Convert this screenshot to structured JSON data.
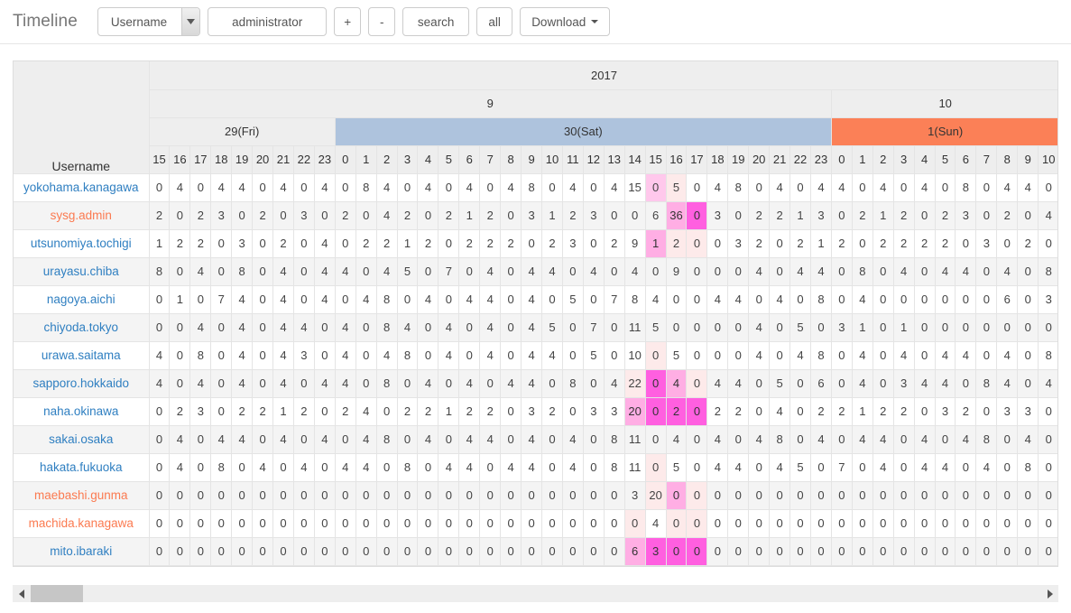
{
  "toolbar": {
    "app_title": "Timeline",
    "filter_field": {
      "selected": "Username",
      "arrow_icon": "chevron-down-icon"
    },
    "filter_value": "administrator",
    "add_label": "+",
    "remove_label": "-",
    "search_label": "search",
    "all_label": "all",
    "download_label": "Download"
  },
  "table": {
    "corner_label": "Username",
    "year": "2017",
    "months": [
      {
        "label": "9",
        "span": 33
      },
      {
        "label": "10",
        "span": 11
      }
    ],
    "days": [
      {
        "label": "29(Fri)",
        "span": 9,
        "kind": "weekday"
      },
      {
        "label": "30(Sat)",
        "span": 24,
        "kind": "saturday"
      },
      {
        "label": "1(Sun)",
        "span": 11,
        "kind": "sunday"
      }
    ],
    "hours": [
      15,
      16,
      17,
      18,
      19,
      20,
      21,
      22,
      23,
      0,
      1,
      2,
      3,
      4,
      5,
      6,
      7,
      8,
      9,
      10,
      11,
      12,
      13,
      14,
      15,
      16,
      17,
      18,
      19,
      20,
      21,
      22,
      23,
      0,
      1,
      2,
      3,
      4,
      5,
      6,
      7,
      8,
      9,
      10
    ],
    "rows": [
      {
        "username": "yokohama.kanagawa",
        "alert": false,
        "values": [
          0,
          4,
          0,
          4,
          4,
          0,
          4,
          0,
          4,
          0,
          8,
          4,
          0,
          4,
          0,
          4,
          0,
          4,
          8,
          0,
          4,
          0,
          4,
          15,
          0,
          5,
          0,
          4,
          8,
          0,
          4,
          0,
          4,
          4,
          0,
          4,
          0,
          4,
          0,
          8,
          0,
          4,
          4,
          0
        ],
        "heat": [
          0,
          0,
          0,
          0,
          0,
          0,
          0,
          0,
          0,
          0,
          0,
          0,
          0,
          0,
          0,
          0,
          0,
          0,
          0,
          0,
          0,
          0,
          0,
          0,
          2,
          1,
          0,
          0,
          0,
          0,
          0,
          0,
          0,
          0,
          0,
          0,
          0,
          0,
          0,
          0,
          0,
          0,
          0,
          0
        ]
      },
      {
        "username": "sysg.admin",
        "alert": true,
        "values": [
          2,
          0,
          2,
          3,
          0,
          2,
          0,
          3,
          0,
          2,
          0,
          4,
          2,
          0,
          2,
          1,
          2,
          0,
          3,
          1,
          2,
          3,
          0,
          0,
          6,
          36,
          0,
          3,
          0,
          2,
          2,
          1,
          3,
          0,
          2,
          1,
          2,
          0,
          2,
          3,
          0,
          2,
          0,
          4
        ],
        "heat": [
          0,
          0,
          0,
          0,
          0,
          0,
          0,
          0,
          0,
          0,
          0,
          0,
          0,
          0,
          0,
          0,
          0,
          0,
          0,
          0,
          0,
          0,
          0,
          0,
          0,
          3,
          4,
          0,
          0,
          0,
          0,
          0,
          0,
          0,
          0,
          0,
          0,
          0,
          0,
          0,
          0,
          0,
          0,
          0
        ]
      },
      {
        "username": "utsunomiya.tochigi",
        "alert": false,
        "values": [
          1,
          2,
          2,
          0,
          3,
          0,
          2,
          0,
          4,
          0,
          2,
          2,
          1,
          2,
          0,
          2,
          2,
          2,
          0,
          2,
          3,
          0,
          2,
          9,
          1,
          2,
          0,
          0,
          3,
          2,
          0,
          2,
          1,
          2,
          0,
          2,
          2,
          2,
          2,
          0,
          3,
          0,
          2,
          0
        ],
        "heat": [
          0,
          0,
          0,
          0,
          0,
          0,
          0,
          0,
          0,
          0,
          0,
          0,
          0,
          0,
          0,
          0,
          0,
          0,
          0,
          0,
          0,
          0,
          0,
          0,
          3,
          1,
          1,
          0,
          0,
          0,
          0,
          0,
          0,
          0,
          0,
          0,
          0,
          0,
          0,
          0,
          0,
          0,
          0,
          0
        ]
      },
      {
        "username": "urayasu.chiba",
        "alert": false,
        "values": [
          8,
          0,
          4,
          0,
          8,
          0,
          4,
          0,
          4,
          4,
          0,
          4,
          5,
          0,
          7,
          0,
          4,
          0,
          4,
          4,
          0,
          4,
          0,
          4,
          0,
          9,
          0,
          0,
          0,
          4,
          0,
          4,
          4,
          0,
          8,
          0,
          4,
          0,
          4,
          4,
          0,
          4,
          0,
          8
        ],
        "heat": [
          0,
          0,
          0,
          0,
          0,
          0,
          0,
          0,
          0,
          0,
          0,
          0,
          0,
          0,
          0,
          0,
          0,
          0,
          0,
          0,
          0,
          0,
          0,
          0,
          0,
          0,
          0,
          0,
          0,
          0,
          0,
          0,
          0,
          0,
          0,
          0,
          0,
          0,
          0,
          0,
          0,
          0,
          0,
          0
        ]
      },
      {
        "username": "nagoya.aichi",
        "alert": false,
        "values": [
          0,
          1,
          0,
          7,
          4,
          0,
          4,
          0,
          4,
          0,
          4,
          8,
          0,
          4,
          0,
          4,
          4,
          0,
          4,
          0,
          5,
          0,
          7,
          8,
          4,
          0,
          0,
          4,
          4,
          0,
          4,
          0,
          8,
          0,
          4,
          0,
          0,
          0,
          0,
          0,
          0,
          6,
          0,
          3
        ],
        "heat": [
          0,
          0,
          0,
          0,
          0,
          0,
          0,
          0,
          0,
          0,
          0,
          0,
          0,
          0,
          0,
          0,
          0,
          0,
          0,
          0,
          0,
          0,
          0,
          0,
          0,
          0,
          0,
          0,
          0,
          0,
          0,
          0,
          0,
          0,
          0,
          0,
          0,
          0,
          0,
          0,
          0,
          0,
          0,
          0
        ]
      },
      {
        "username": "chiyoda.tokyo",
        "alert": false,
        "values": [
          0,
          0,
          4,
          0,
          4,
          0,
          4,
          4,
          0,
          4,
          0,
          8,
          4,
          0,
          4,
          0,
          4,
          0,
          4,
          5,
          0,
          7,
          0,
          11,
          5,
          0,
          0,
          0,
          0,
          4,
          0,
          5,
          0,
          3,
          1,
          0,
          1,
          0,
          0,
          0,
          0,
          0,
          0,
          0
        ],
        "heat": [
          0,
          0,
          0,
          0,
          0,
          0,
          0,
          0,
          0,
          0,
          0,
          0,
          0,
          0,
          0,
          0,
          0,
          0,
          0,
          0,
          0,
          0,
          0,
          0,
          0,
          0,
          0,
          0,
          0,
          0,
          0,
          0,
          0,
          0,
          0,
          0,
          0,
          0,
          0,
          0,
          0,
          0,
          0,
          0
        ]
      },
      {
        "username": "urawa.saitama",
        "alert": false,
        "values": [
          4,
          0,
          8,
          0,
          4,
          0,
          4,
          3,
          0,
          4,
          0,
          4,
          8,
          0,
          4,
          0,
          4,
          0,
          4,
          4,
          0,
          5,
          0,
          10,
          0,
          5,
          0,
          0,
          0,
          4,
          0,
          4,
          8,
          0,
          4,
          0,
          4,
          0,
          4,
          4,
          0,
          4,
          0,
          8
        ],
        "heat": [
          0,
          0,
          0,
          0,
          0,
          0,
          0,
          0,
          0,
          0,
          0,
          0,
          0,
          0,
          0,
          0,
          0,
          0,
          0,
          0,
          0,
          0,
          0,
          0,
          1,
          0,
          0,
          0,
          0,
          0,
          0,
          0,
          0,
          0,
          0,
          0,
          0,
          0,
          0,
          0,
          0,
          0,
          0,
          0
        ]
      },
      {
        "username": "sapporo.hokkaido",
        "alert": false,
        "values": [
          4,
          0,
          4,
          0,
          4,
          0,
          4,
          0,
          4,
          4,
          0,
          8,
          0,
          4,
          0,
          4,
          0,
          4,
          4,
          0,
          8,
          0,
          4,
          22,
          0,
          4,
          0,
          4,
          4,
          0,
          5,
          0,
          6,
          0,
          4,
          0,
          3,
          4,
          4,
          0,
          8,
          4,
          0,
          4
        ],
        "heat": [
          0,
          0,
          0,
          0,
          0,
          0,
          0,
          0,
          0,
          0,
          0,
          0,
          0,
          0,
          0,
          0,
          0,
          0,
          0,
          0,
          0,
          0,
          0,
          1,
          4,
          3,
          1,
          0,
          0,
          0,
          0,
          0,
          0,
          0,
          0,
          0,
          0,
          0,
          0,
          0,
          0,
          0,
          0,
          0
        ]
      },
      {
        "username": "naha.okinawa",
        "alert": false,
        "values": [
          0,
          2,
          3,
          0,
          2,
          2,
          1,
          2,
          0,
          2,
          4,
          0,
          2,
          2,
          1,
          2,
          2,
          0,
          3,
          2,
          0,
          3,
          3,
          20,
          0,
          2,
          0,
          2,
          2,
          0,
          4,
          0,
          2,
          2,
          1,
          2,
          2,
          0,
          3,
          2,
          0,
          3,
          3,
          0
        ],
        "heat": [
          0,
          0,
          0,
          0,
          0,
          0,
          0,
          0,
          0,
          0,
          0,
          0,
          0,
          0,
          0,
          0,
          0,
          0,
          0,
          0,
          0,
          0,
          0,
          3,
          4,
          4,
          4,
          0,
          0,
          0,
          0,
          0,
          0,
          0,
          0,
          0,
          0,
          0,
          0,
          0,
          0,
          0,
          0,
          0
        ]
      },
      {
        "username": "sakai.osaka",
        "alert": false,
        "values": [
          0,
          4,
          0,
          4,
          4,
          0,
          4,
          0,
          4,
          0,
          4,
          8,
          0,
          4,
          0,
          4,
          4,
          0,
          4,
          0,
          4,
          0,
          8,
          11,
          0,
          4,
          0,
          4,
          0,
          4,
          8,
          0,
          4,
          0,
          4,
          4,
          0,
          4,
          0,
          4,
          8,
          0,
          4,
          0
        ],
        "heat": [
          0,
          0,
          0,
          0,
          0,
          0,
          0,
          0,
          0,
          0,
          0,
          0,
          0,
          0,
          0,
          0,
          0,
          0,
          0,
          0,
          0,
          0,
          0,
          0,
          0,
          0,
          0,
          0,
          0,
          0,
          0,
          0,
          0,
          0,
          0,
          0,
          0,
          0,
          0,
          0,
          0,
          0,
          0,
          0
        ]
      },
      {
        "username": "hakata.fukuoka",
        "alert": false,
        "values": [
          0,
          4,
          0,
          8,
          0,
          4,
          0,
          4,
          0,
          4,
          4,
          0,
          8,
          0,
          4,
          4,
          0,
          4,
          4,
          0,
          4,
          0,
          8,
          11,
          0,
          5,
          0,
          4,
          4,
          0,
          4,
          5,
          0,
          7,
          0,
          4,
          0,
          4,
          4,
          0,
          4,
          0,
          8,
          0
        ],
        "heat": [
          0,
          0,
          0,
          0,
          0,
          0,
          0,
          0,
          0,
          0,
          0,
          0,
          0,
          0,
          0,
          0,
          0,
          0,
          0,
          0,
          0,
          0,
          0,
          0,
          1,
          0,
          0,
          0,
          0,
          0,
          0,
          0,
          0,
          0,
          0,
          0,
          0,
          0,
          0,
          0,
          0,
          0,
          0,
          0
        ]
      },
      {
        "username": "maebashi.gunma",
        "alert": true,
        "values": [
          0,
          0,
          0,
          0,
          0,
          0,
          0,
          0,
          0,
          0,
          0,
          0,
          0,
          0,
          0,
          0,
          0,
          0,
          0,
          0,
          0,
          0,
          0,
          3,
          20,
          0,
          0,
          0,
          0,
          0,
          0,
          0,
          0,
          0,
          0,
          0,
          0,
          0,
          0,
          0,
          0,
          0,
          0,
          0
        ],
        "heat": [
          0,
          0,
          0,
          0,
          0,
          0,
          0,
          0,
          0,
          0,
          0,
          0,
          0,
          0,
          0,
          0,
          0,
          0,
          0,
          0,
          0,
          0,
          0,
          0,
          1,
          3,
          1,
          0,
          0,
          0,
          0,
          0,
          0,
          0,
          0,
          0,
          0,
          0,
          0,
          0,
          0,
          0,
          0,
          0
        ]
      },
      {
        "username": "machida.kanagawa",
        "alert": true,
        "values": [
          0,
          0,
          0,
          0,
          0,
          0,
          0,
          0,
          0,
          0,
          0,
          0,
          0,
          0,
          0,
          0,
          0,
          0,
          0,
          0,
          0,
          0,
          0,
          0,
          4,
          0,
          0,
          0,
          0,
          0,
          0,
          0,
          0,
          0,
          0,
          0,
          0,
          0,
          0,
          0,
          0,
          0,
          0,
          0
        ],
        "heat": [
          0,
          0,
          0,
          0,
          0,
          0,
          0,
          0,
          0,
          0,
          0,
          0,
          0,
          0,
          0,
          0,
          0,
          0,
          0,
          0,
          0,
          0,
          0,
          1,
          0,
          1,
          1,
          0,
          0,
          0,
          0,
          0,
          0,
          0,
          0,
          0,
          0,
          0,
          0,
          0,
          0,
          0,
          0,
          0
        ]
      },
      {
        "username": "mito.ibaraki",
        "alert": false,
        "values": [
          0,
          0,
          0,
          0,
          0,
          0,
          0,
          0,
          0,
          0,
          0,
          0,
          0,
          0,
          0,
          0,
          0,
          0,
          0,
          0,
          0,
          0,
          0,
          6,
          3,
          0,
          0,
          0,
          0,
          0,
          0,
          0,
          0,
          0,
          0,
          0,
          0,
          0,
          0,
          0,
          0,
          0,
          0,
          0
        ],
        "heat": [
          0,
          0,
          0,
          0,
          0,
          0,
          0,
          0,
          0,
          0,
          0,
          0,
          0,
          0,
          0,
          0,
          0,
          0,
          0,
          0,
          0,
          0,
          0,
          3,
          4,
          4,
          4,
          0,
          0,
          0,
          0,
          0,
          0,
          0,
          0,
          0,
          0,
          0,
          0,
          0,
          0,
          0,
          0,
          0
        ]
      }
    ]
  },
  "scrollbar": {
    "left_arrow_icon": "chevron-left-icon",
    "right_arrow_icon": "chevron-right-icon"
  },
  "colors": {
    "saturday_header": "#aec3dd",
    "sunday_header": "#fb8057",
    "username_link": "#2f7fc1",
    "username_alert": "#fb7a50",
    "heat_1": "#fdeaea",
    "heat_2": "#ffc8ec",
    "heat_3": "#ffaee4",
    "heat_4": "#ff5fe0"
  }
}
